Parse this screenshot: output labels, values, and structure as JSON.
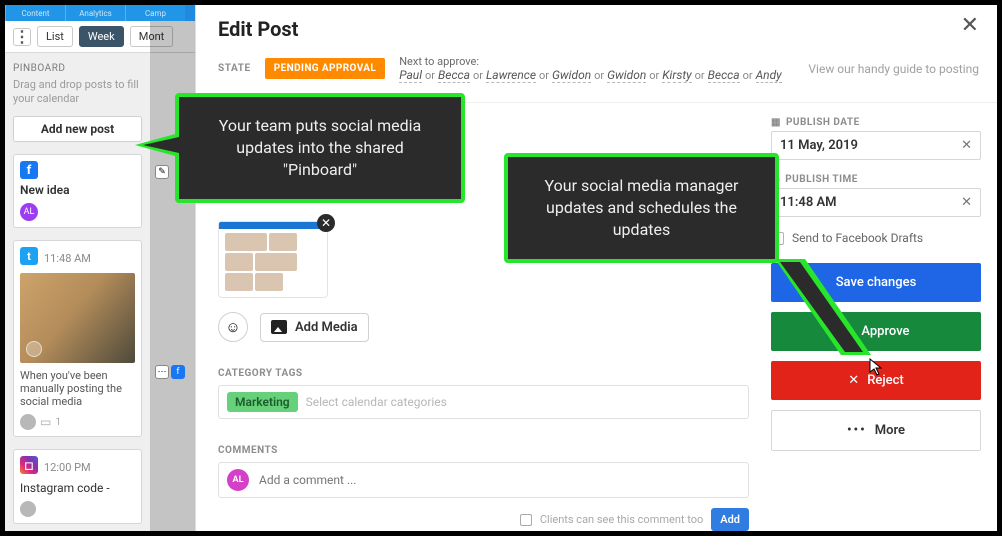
{
  "nav_tabs": {
    "t1": "Content",
    "t2": "Analytics",
    "t3": "Camp"
  },
  "toolbar": {
    "list": "List",
    "week": "Week",
    "month": "Mont"
  },
  "sidebar": {
    "heading": "PINBOARD",
    "hint": "Drag and drop posts to fill your calendar",
    "add_post": "Add new post",
    "cards": [
      {
        "idea_title": "New idea"
      },
      {
        "time": "11:48 AM",
        "desc": "When you've been manually posting the social media"
      },
      {
        "time": "12:00 PM",
        "title": "Instagram code -"
      }
    ]
  },
  "modal": {
    "title": "Edit Post",
    "state_label": "STATE",
    "badge": "PENDING APPROVAL",
    "approvers_label": "Next to approve:",
    "or": "or",
    "approvers": [
      "Paul",
      "Becca",
      "Lawrence",
      "Gwidon",
      "Gwidon",
      "Kirsty",
      "Becca",
      "Andy"
    ],
    "guide": "View our handy guide to posting",
    "add_media": "Add Media",
    "category_label": "CATEGORY TAGS",
    "tag": "Marketing",
    "category_placeholder": "Select calendar categories",
    "comments_label": "COMMENTS",
    "comment_placeholder": "Add a comment ...",
    "clients_see": "Clients can see this comment too",
    "add": "Add",
    "right": {
      "publish_date_label": "PUBLISH DATE",
      "publish_date": "11 May, 2019",
      "publish_time_label": "PUBLISH TIME",
      "publish_time": "11:48 AM",
      "send_drafts": "Send to Facebook Drafts",
      "save": "Save changes",
      "approve": "Approve",
      "reject": "Reject",
      "more": "More"
    }
  },
  "callouts": {
    "c1": "Your team puts social media updates into the shared \"Pinboard\"",
    "c2": "Your social media manager updates and schedules the updates"
  }
}
